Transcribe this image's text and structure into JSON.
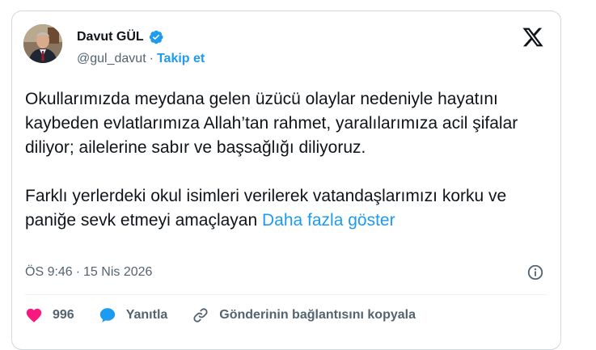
{
  "author": {
    "display_name": "Davut GÜL",
    "handle": "@gul_davut",
    "separator": "·",
    "follow_label": "Takip et"
  },
  "tweet": {
    "paragraph1": "Okullarımızda meydana gelen üzücü olaylar nedeniyle hayatını kaybeden evlatlarımıza Allah’tan rahmet, yaralılarımıza acil şifalar diliyor; ailelerine sabır ve başsağlığı diliyoruz.",
    "paragraph2": "Farklı yerlerdeki okul isimleri verilerek vatandaşlarımızı korku ve paniğe sevk etmeyi amaçlayan",
    "show_more_label": "Daha fazla göster"
  },
  "meta": {
    "time": "ÖS 9:46",
    "separator": "·",
    "date": "15 Nis 2026"
  },
  "actions": {
    "like_count": "996",
    "reply_label": "Yanıtla",
    "copy_link_label": "Gönderinin bağlantısını kopyala"
  },
  "icons": {
    "verified": "verified-badge-icon",
    "logo": "x-logo-icon",
    "info": "info-icon",
    "like": "heart-icon",
    "reply": "speech-bubble-icon",
    "link": "link-icon"
  },
  "colors": {
    "accent": "#1d9bf0",
    "like": "#f91880",
    "muted": "#536471",
    "text": "#0f1419",
    "border": "#cfd9de"
  }
}
